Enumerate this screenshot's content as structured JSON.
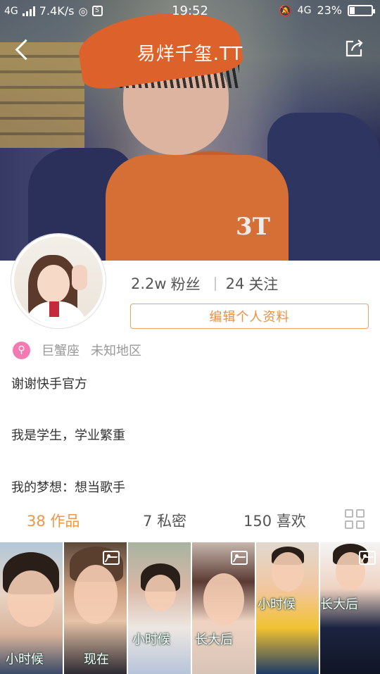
{
  "status_bar": {
    "network": "4G",
    "speed": "7.4K/s",
    "time": "19:52",
    "network_right": "4G",
    "battery_percent": "23%",
    "battery_level": 0.23
  },
  "nav": {
    "title": "易烊千玺.TT"
  },
  "cover": {
    "shirt_logo": "3T"
  },
  "profile": {
    "fans_count": "2.2w",
    "fans_label": "粉丝",
    "following_count": "24",
    "following_label": "关注",
    "edit_button": "编辑个人资料",
    "zodiac": "巨蟹座",
    "location": "未知地区",
    "bio_lines": [
      "谢谢快手官方",
      "我是学生，学业繁重",
      "我的梦想：想当歌手"
    ]
  },
  "tabs": [
    {
      "count": "38",
      "label": "作品",
      "active": true
    },
    {
      "count": "7",
      "label": "私密",
      "active": false
    },
    {
      "count": "150",
      "label": "喜欢",
      "active": false
    }
  ],
  "thumbnails": [
    {
      "caption": "小时候",
      "photo_icon": false
    },
    {
      "caption": "现在",
      "photo_icon": true
    },
    {
      "caption": "小时候",
      "photo_icon": false
    },
    {
      "caption": "长大后",
      "photo_icon": true
    },
    {
      "caption": "小时候",
      "photo_icon": false
    },
    {
      "caption": "长大后",
      "photo_icon": true
    }
  ],
  "colors": {
    "accent": "#ef9645",
    "zodiac_icon": "#f37bb2",
    "text_muted": "#999999"
  },
  "icons": {
    "back": "chevron-left-icon",
    "edit": "share-edit-icon",
    "zodiac": "zodiac-badge-icon",
    "grid": "grid-toggle-icon",
    "photo": "photo-icon"
  }
}
